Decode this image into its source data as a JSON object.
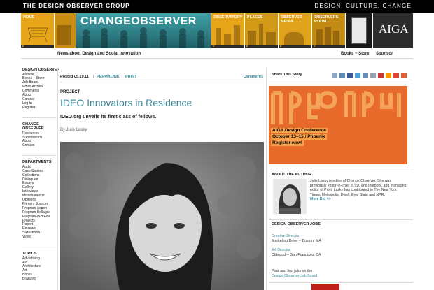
{
  "topbar": {
    "brand": "THE DESIGN OBSERVER GROUP",
    "tagline": "DESIGN, CULTURE, CHANGE"
  },
  "nav": {
    "home": "HOME",
    "change_observer": "CHANGEOBSERVER",
    "observatory": "OBSERVATORY",
    "places": "PLACES",
    "media": "OBSERVER MEDIA",
    "room": "OBSERVERS ROOM",
    "aiga": "AIGA"
  },
  "header": {
    "news_about": "News about Design and Social Innovation",
    "books": "Books + Store",
    "sponsor": "Sponsor"
  },
  "sidebar": {
    "groups": [
      {
        "title": "DESIGN OBSERVER",
        "items": [
          "Archive",
          "Books + Store",
          "Job Board",
          "Email Archive",
          "Comments",
          "About",
          "Contact",
          "Log In",
          "Register"
        ]
      },
      {
        "title": "CHANGE OBSERVER",
        "items": [
          "Resources",
          "Submissions",
          "About",
          "Contact"
        ]
      },
      {
        "title": "DEPARTMENTS",
        "items": [
          "Audio",
          "Case Studies",
          "Collections",
          "Dialogues",
          "Essays",
          "Gallery",
          "Interviews",
          "Miscellaneous",
          "Opinions",
          "Primary Sources",
          "Program-Aspen",
          "Program-Bellagio",
          "Program-WH Edu",
          "Projects",
          "Report",
          "Reviews",
          "Slideshows",
          "Video"
        ]
      },
      {
        "title": "TOPICS",
        "items": [
          "Advertising",
          "Aid",
          "Architecture",
          "Art",
          "Books",
          "Branding"
        ]
      }
    ]
  },
  "post": {
    "posted": "Posted 05.19.11",
    "permalink": "PERMALINK",
    "print": "PRINT",
    "comments": "Comments",
    "kicker": "PROJECT",
    "title": "IDEO Innovators in Residence",
    "subtitle": "IDEO.org unveils its first class of fellows.",
    "byline": "By Julie Lasky"
  },
  "right": {
    "share_label": "Share This Story",
    "ad_lines": [
      "AIGA Design Conference",
      "October 13–15 / Phoenix",
      "Register now!"
    ],
    "about_head": "ABOUT THE AUTHOR",
    "about_text": "Julie Lasky is editor of Change Observer. She was previously editor-in-chief of I.D. and Interiors, and managing editor of Print. Lasky has contributed to The New York Times, Metropolis, Dwell, Eye, Slate and NPR.",
    "more_bio": "More Bio >>",
    "jobs_head": "DESIGN OBSERVER JOBS",
    "jobs": [
      {
        "title": "Creative Director",
        "detail": "Marketing Drive -- Boston, MA"
      },
      {
        "title": "Art Director",
        "detail": "Oldepod -- San Francisco, CA"
      }
    ],
    "jobs_post": "Post and find jobs on the",
    "jobs_board": "Design Observer Job Board"
  },
  "colors": {
    "accent": "#3a8a9a",
    "nav_gold": "#e7a61a",
    "ad_orange": "#e76a2a"
  }
}
